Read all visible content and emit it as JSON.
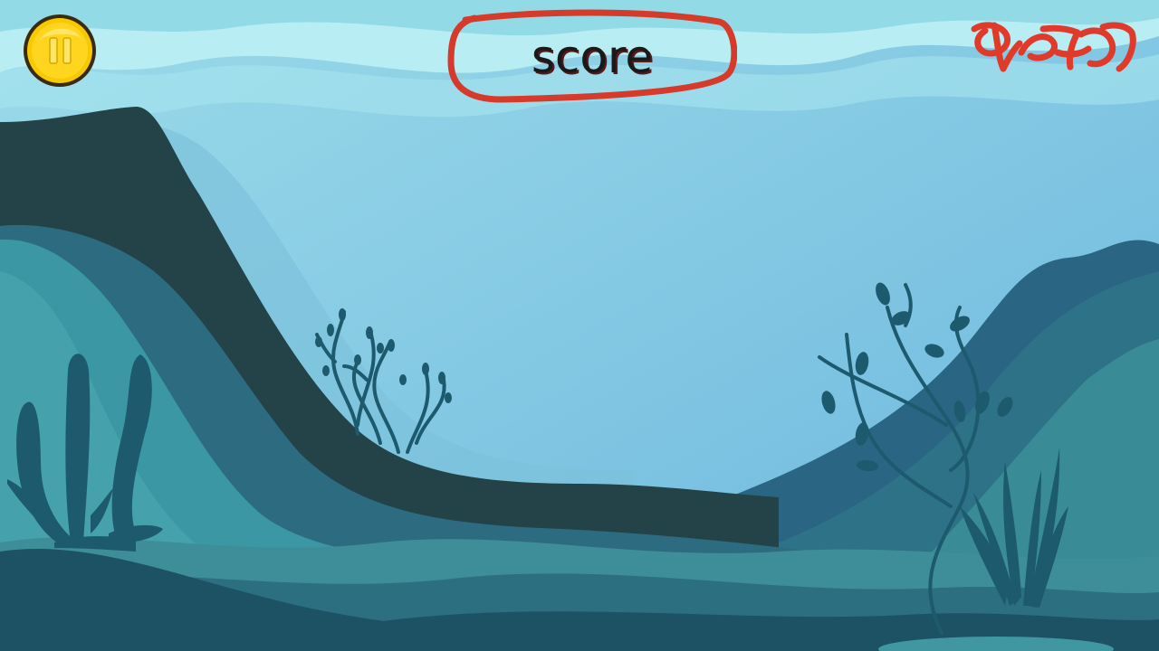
{
  "hud": {
    "pause_button": {
      "icon": "pause-icon",
      "color": "#f7c900"
    },
    "score": {
      "label": "score",
      "circle_color": "#d63a2a"
    },
    "lives_scribble": {
      "icon": "red-scribble-icon",
      "color": "#e03a2a"
    }
  },
  "scene": {
    "sky_color": "#8fd3e6",
    "wave_colors": [
      "#b7ecf3",
      "#a4e3ee",
      "#7fc7e3"
    ],
    "hill_dark": "#234348",
    "hill_mid": "#2f6f82",
    "hill_teal": "#3a97a3",
    "seabed": "#1d5265",
    "plant_color": "#1e5a6e"
  }
}
